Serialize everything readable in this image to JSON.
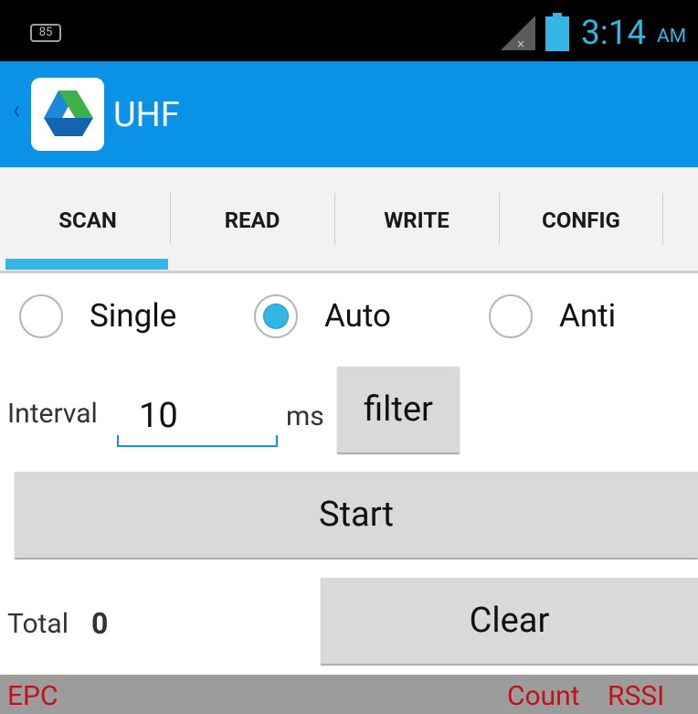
{
  "status_bar": {
    "notification_badge": "85",
    "time": "3:14",
    "ampm": "AM",
    "icons": [
      "no-signal-icon",
      "battery-icon"
    ],
    "accent_color": "#33b5e5"
  },
  "action_bar": {
    "title": "UHF",
    "back_chevron": "‹",
    "color": "#0a93e6"
  },
  "tabs": [
    {
      "label": "SCAN",
      "selected": true
    },
    {
      "label": "READ",
      "selected": false
    },
    {
      "label": "WRITE",
      "selected": false
    },
    {
      "label": "CONFIG",
      "selected": false
    }
  ],
  "scan_mode": {
    "options": [
      {
        "label": "Single",
        "checked": false
      },
      {
        "label": "Auto",
        "checked": true
      },
      {
        "label": "Anti",
        "checked": false
      }
    ]
  },
  "interval": {
    "label": "Interval",
    "value": "10",
    "unit": "ms",
    "filter_label": "filter"
  },
  "controls": {
    "start_label": "Start",
    "clear_label": "Clear",
    "total_label": "Total",
    "total_value": "0"
  },
  "list_header": {
    "epc": "EPC",
    "count": "Count",
    "rssi": "RSSI",
    "text_color": "#c0141a"
  }
}
